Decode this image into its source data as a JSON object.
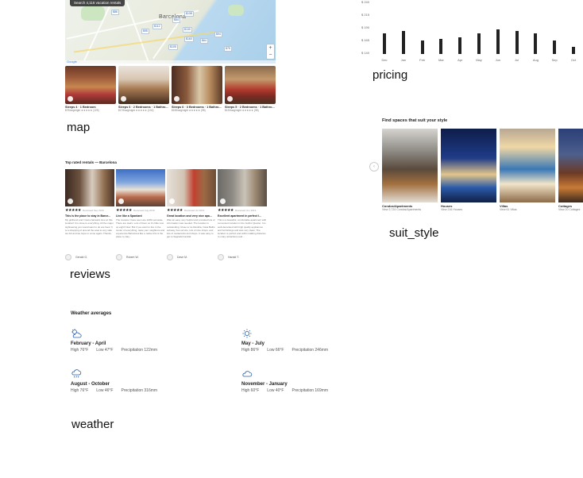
{
  "map": {
    "search_chip": "Search 4,116 vacation rentals",
    "city_label": "Barcelona",
    "price_pins": [
      "$86",
      "$138",
      "$54",
      "$112",
      "$95",
      "$130",
      "$94",
      "$160",
      "$64",
      "$105",
      "$75"
    ],
    "zoom_in": "+",
    "zoom_out": "−",
    "google_label": "Google",
    "listings": [
      {
        "title": "Sleeps 4 · 1 Bedroom",
        "sub": "$79/avg/night ★★★★★ (125)"
      },
      {
        "title": "Sleeps 6 · 2 Bedrooms · 1 Bathro...",
        "sub": "$175/avg/night ★★★★★ (100)"
      },
      {
        "title": "Sleeps 6 · 3 Bedrooms · 1 Bathro...",
        "sub": "$155/avg/night ★★★★★ (98)"
      },
      {
        "title": "Sleeps 5 · 2 Bedrooms · 1 Bathro...",
        "sub": "$133/avg/night ★★★★★ (98)"
      }
    ],
    "caption": "map"
  },
  "pricing": {
    "caption": "pricing",
    "chart_data": {
      "type": "bar",
      "categories": [
        "Dec",
        "Jan",
        "Feb",
        "Mar",
        "Apr",
        "May",
        "Jun",
        "Jul",
        "Aug",
        "Sep",
        "Oct"
      ],
      "values": [
        204,
        207,
        196,
        198,
        200,
        204,
        209,
        207,
        204,
        196,
        188
      ],
      "ylim": [
        180,
        240
      ],
      "yticks": [
        "$ 240",
        "$ 215",
        "$ 190",
        "$ 165",
        "$ 140"
      ],
      "xlabel": "",
      "ylabel": ""
    }
  },
  "reviews": {
    "title": "Top rated rentals — Barcelona",
    "caption": "reviews",
    "cards": [
      {
        "stars": "★★★★★",
        "date": "Reviewed Sep 2019",
        "title": "This is the place to stay in Barce...",
        "body": "My girlfriend and I had a fantastic time at this location! It is close to everything. All the major sightseeing you would want to do are here! It is a shopping of around the area is very safe we felt and we hope to come again. Thanks.",
        "author": "Gerald G."
      },
      {
        "stars": "★★★★★",
        "date": "Reviewed Aug 2019",
        "title": "Live like a Spaniard",
        "body": "The reviews I have seen are 100% accurate. There are stairs. Lots of them so it's little now up eight! Now. But if you want to live in the center of everything, taste your neighbors and experience Barcelona like a native this is the place to stay...",
        "author": "Robert W."
      },
      {
        "stars": "★★★★★",
        "date": "Reviewed Jul 2019",
        "title": "Great location and very nice apa...",
        "body": "Was an easy very helpful and provided lots of information was needed. The location is outstanding. Close to La Rambla, Casa Batllo subway, bus service, lots of nice shops, and lots of restaurants and shops. It was easy to get to Sagrada Familia.",
        "author": "Dave M."
      },
      {
        "stars": "★★★★★",
        "date": "Reviewed Jun 2019",
        "title": "Excellent apartment in perfect l...",
        "body": "This is a beautiful, comfortable apartment with convenient location in the Gothic Quarter. It is well-decorated with high quality appliances and furnishings and was very clean. The location is perfect and within walking distance to many attractions and...",
        "author": "Harald T."
      }
    ]
  },
  "suit_style": {
    "title": "Find spaces that suit your style",
    "caption": "suit_style",
    "arrow": "‹",
    "items": [
      {
        "name": "Condos/Apartments",
        "count": "View 3,724 Condos/Apartments"
      },
      {
        "name": "Houses",
        "count": "View 216 Houses"
      },
      {
        "name": "Villas",
        "count": "View 61 Villas"
      },
      {
        "name": "Cottages",
        "count": "View 20 Cottages"
      }
    ]
  },
  "weather": {
    "title": "Weather averages",
    "caption": "weather",
    "seasons": [
      {
        "name": "February - April",
        "high": "High 76°F",
        "low": "Low 47°F",
        "precip": "Precipitation 122mm",
        "icon": "partly-cloudy-icon"
      },
      {
        "name": "May - July",
        "high": "High 86°F",
        "low": "Low 66°F",
        "precip": "Precipitation 246mm",
        "icon": "sun-icon"
      },
      {
        "name": "August - October",
        "high": "High 76°F",
        "low": "Low 46°F",
        "precip": "Precipitation 316mm",
        "icon": "rain-cloud-icon"
      },
      {
        "name": "November - January",
        "high": "High 60°F",
        "low": "Low 40°F",
        "precip": "Precipitation 169mm",
        "icon": "cloud-icon"
      }
    ]
  }
}
